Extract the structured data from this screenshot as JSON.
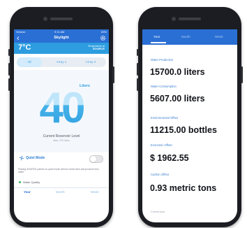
{
  "left_screen": {
    "status": {
      "carrier": "Verizon",
      "time": "9:11 AM",
      "battery": "83%"
    },
    "nav": {
      "title": "Skylight"
    },
    "weather": {
      "temperature": "7°C",
      "source_line1": "Temperature at",
      "source_line2": "SOURCE"
    },
    "array_tabs": [
      {
        "label": "All",
        "active": true
      },
      {
        "label": "Array 1",
        "active": false
      },
      {
        "label": "Array 2",
        "active": false
      }
    ],
    "gauge": {
      "value": "40",
      "unit": "Liters",
      "caption": "Current Reservoir Level",
      "sub": "Max: 370 liters"
    },
    "quiet_mode": {
      "label": "Quiet Mode",
      "enabled": false,
      "description": "Placing SOURCE panels on quiet mode will turn down fans and produce less water"
    },
    "water_quality": {
      "label": "Water Quality",
      "status_color": "#3cb35a"
    },
    "bottom_tabs": [
      {
        "label": "Year",
        "active": true
      },
      {
        "label": "Month",
        "active": false
      },
      {
        "label": "Week",
        "active": false
      }
    ]
  },
  "right_screen": {
    "tabs": [
      {
        "label": "Year",
        "active": true
      },
      {
        "label": "Month",
        "active": false
      },
      {
        "label": "Week",
        "active": false
      }
    ],
    "stats": [
      {
        "label": "Water Production",
        "value": "15700.0 liters"
      },
      {
        "label": "Water Consumption",
        "value": "5607.00 liters"
      },
      {
        "label": "Environmental Offset",
        "value": "11215.00 bottles"
      },
      {
        "label": "Economic Offset",
        "value": "$ 1962.55"
      },
      {
        "label": "Carbon Offset",
        "value": "0.93 metric tons"
      }
    ],
    "footer": "Current year"
  },
  "colors": {
    "primary": "#2a6fd4",
    "accent": "#2d9de0",
    "phone_body": "#1b1d22"
  }
}
